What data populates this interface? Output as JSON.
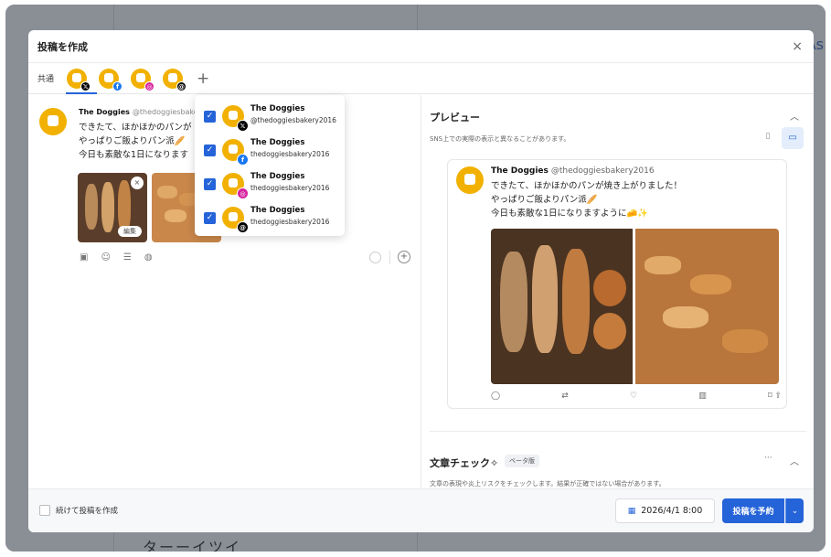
{
  "modal": {
    "title": "投稿を作成",
    "close": "×"
  },
  "tabs": {
    "common": "共通",
    "add": "+"
  },
  "post": {
    "name": "The Doggies",
    "handle": "@thedoggiesbakery",
    "text": "できたて、ほかほかのパンが\nやっぱりご飯よりパン派🥖\n今日も素敵な1日になります",
    "edit_label": "編集",
    "remove": "×"
  },
  "accounts": [
    {
      "name": "The Doggies",
      "handle": "@thedoggiesbakery2016",
      "badge": "𝕏",
      "badge_class": "b-x"
    },
    {
      "name": "The Doggies",
      "handle": "thedoggiesbakery2016",
      "badge": "f",
      "badge_class": "b-fb"
    },
    {
      "name": "The Doggies",
      "handle": "thedoggiesbakery2016",
      "badge": "◎",
      "badge_class": "b-ig"
    },
    {
      "name": "The Doggies",
      "handle": "thedoggiesbakery2016",
      "badge": "@",
      "badge_class": "b-th"
    }
  ],
  "preview": {
    "title": "プレビュー",
    "subtitle": "SNS上での実際の表示と異なることがあります。",
    "card_name": "The Doggies",
    "card_handle": "@thedoggiesbakery2016",
    "card_text": "できたて、ほかほかのパンが焼き上がりました！\nやっぱりご飯よりパン派🥖\n今日も素敵な1日になりますように🧀✨"
  },
  "check": {
    "title": "文章チェック✧",
    "beta": "ベータ版",
    "more": "···",
    "subtitle": "文章の表現や炎上リスクをチェックします。結果が正確ではない場合があります。"
  },
  "footer": {
    "continue_label": "続けて投稿を作成",
    "date": "2026/4/1 8:00",
    "schedule": "投稿を予約",
    "dropdown": "⌄"
  },
  "background": {
    "right_text": "As",
    "bottom_text": "ターーイツイ"
  }
}
